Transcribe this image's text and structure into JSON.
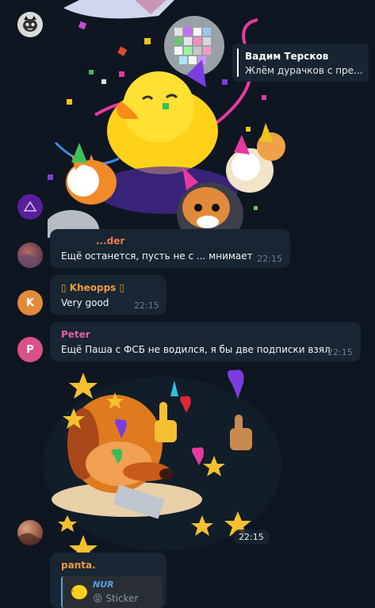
{
  "chat": {
    "reply_preview": {
      "author": "Вадим Терсков",
      "snippet": "Жлём дурачков с пре..."
    },
    "messages": [
      {
        "sender": "...der",
        "text": "Ещё останется, пусть не с ... мнимает",
        "time": "22:15",
        "sender_color": "#ee7a4b"
      },
      {
        "sender": "▯ Kheopps ▯",
        "text": "Very good",
        "time": "22:15",
        "sender_color": "#ee9a3e",
        "avatar_letter": "K",
        "avatar_color": "#e28a3b"
      },
      {
        "sender": "Peter",
        "text": "Ещё Паша с ФСБ не водился, я бы две подписки взял",
        "time": "22:15",
        "sender_color": "#e3629b",
        "avatar_letter": "P",
        "avatar_color": "#d9508a"
      }
    ],
    "sticker_time": "22:15",
    "panta": {
      "sender": "panta.",
      "sender_color": "#ee9a3e",
      "reply_author": "NUR",
      "reply_kind": "Sticker",
      "reply_kind_emoji": "😝"
    },
    "colors": {
      "background": "#0e1621",
      "bubble": "#182533",
      "timestamp": "#6d7f8f"
    },
    "icons": [
      "avatar-cat-mask",
      "avatar-triangle",
      "avatar-photo",
      "party-duck-sticker",
      "dog-likes-sticker"
    ]
  }
}
